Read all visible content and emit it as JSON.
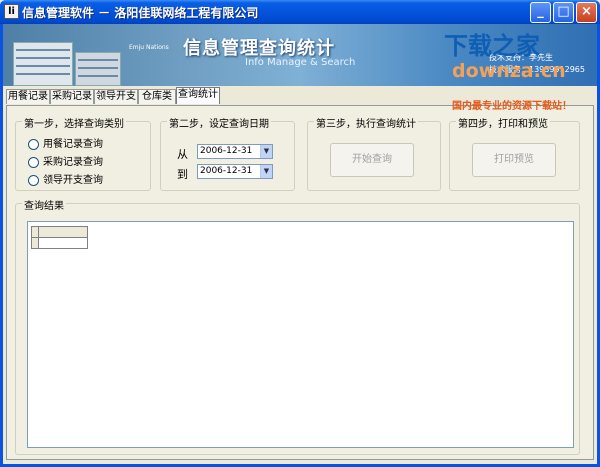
{
  "window": {
    "title": "信息管理软件 － 洛阳佳联网络工程有限公司",
    "icon_glyph": "li",
    "minimize_glyph": "_",
    "maximize_glyph": "□",
    "close_glyph": "×"
  },
  "banner": {
    "title": "信息管理查询统计",
    "subtitle": "Info Manage & Search",
    "small_text": "Emju Nations",
    "contact_line1": "技术支持：李先生",
    "contact_line2": "技术服务：13939912965"
  },
  "watermark": {
    "line1": "下载之家",
    "line2": "downza.cn",
    "line3": "国内最专业的资源下载站！"
  },
  "tabs": [
    {
      "label": "用餐记录",
      "active": false
    },
    {
      "label": "采购记录",
      "active": false
    },
    {
      "label": "领导开支",
      "active": false
    },
    {
      "label": "仓库类",
      "active": false
    },
    {
      "label": "查询统计",
      "active": true
    }
  ],
  "step1": {
    "title": "第一步，选择查询类别",
    "options": [
      "用餐记录查询",
      "采购记录查询",
      "领导开支查询"
    ]
  },
  "step2": {
    "title": "第二步，设定查询日期",
    "from_label": "从",
    "to_label": "到",
    "from_value": "2006-12-31",
    "to_value": "2006-12-31",
    "dropdown_glyph": "▼"
  },
  "step3": {
    "title": "第三步，执行查询统计",
    "button": "开始查询"
  },
  "step4": {
    "title": "第四步，打印和预览",
    "button": "打印预览"
  },
  "results": {
    "title": "查询结果"
  },
  "colors": {
    "titlebar": "#0553dc",
    "panel_bg": "#f1efe2",
    "window_bg": "#ece9d8"
  }
}
